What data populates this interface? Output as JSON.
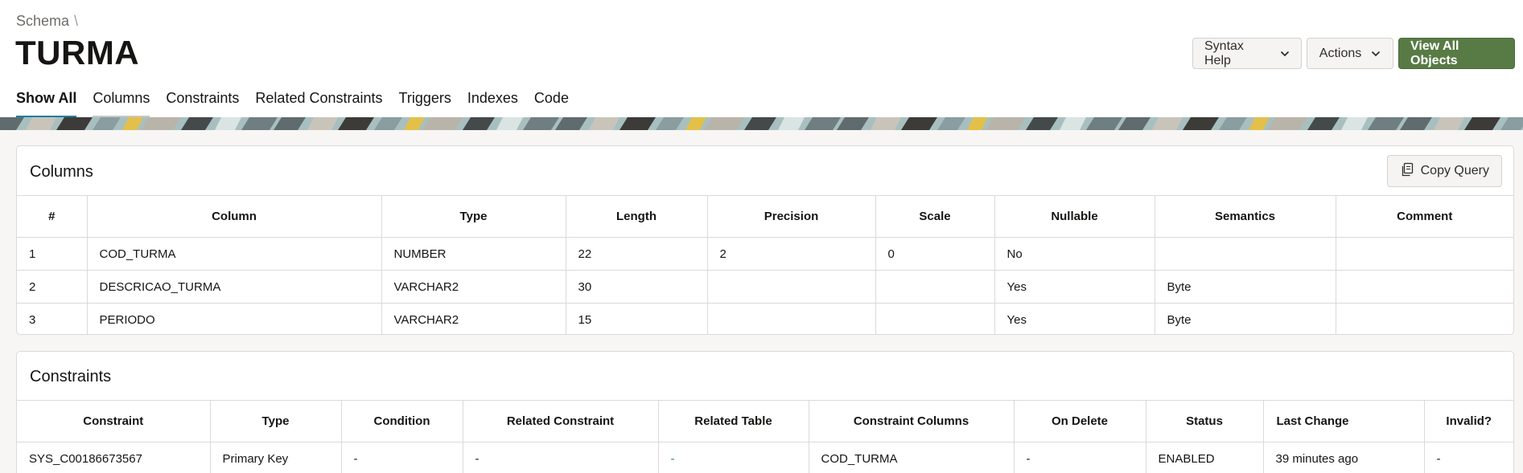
{
  "breadcrumb": {
    "label": "Schema",
    "separator": "\\"
  },
  "page_title": "TURMA",
  "header_actions": {
    "syntax_help": "Syntax Help",
    "actions": "Actions",
    "view_all": "View All Objects"
  },
  "tabs": [
    {
      "label": "Show All",
      "active": true
    },
    {
      "label": "Columns"
    },
    {
      "label": "Constraints"
    },
    {
      "label": "Related Constraints"
    },
    {
      "label": "Triggers"
    },
    {
      "label": "Indexes"
    },
    {
      "label": "Code"
    }
  ],
  "colors": {
    "accent": "#227e9e",
    "primary_button": "#587b45",
    "background": "#f7f6f4"
  },
  "columns_card": {
    "title": "Columns",
    "copy_label": "Copy Query",
    "headers": [
      "#",
      "Column",
      "Type",
      "Length",
      "Precision",
      "Scale",
      "Nullable",
      "Semantics",
      "Comment"
    ],
    "rows": [
      [
        "1",
        "COD_TURMA",
        "NUMBER",
        "22",
        "2",
        "0",
        "No",
        "",
        ""
      ],
      [
        "2",
        "DESCRICAO_TURMA",
        "VARCHAR2",
        "30",
        "",
        "",
        "Yes",
        "Byte",
        ""
      ],
      [
        "3",
        "PERIODO",
        "VARCHAR2",
        "15",
        "",
        "",
        "Yes",
        "Byte",
        ""
      ]
    ]
  },
  "constraints_card": {
    "title": "Constraints",
    "headers": [
      "Constraint",
      "Type",
      "Condition",
      "Related Constraint",
      "Related Table",
      "Constraint Columns",
      "On Delete",
      "Status",
      "Last Change",
      "Invalid?"
    ],
    "rows": [
      [
        "SYS_C00186673567",
        "Primary Key",
        "-",
        "-",
        "-",
        "COD_TURMA",
        "-",
        "ENABLED",
        "39 minutes ago",
        "-"
      ]
    ]
  }
}
